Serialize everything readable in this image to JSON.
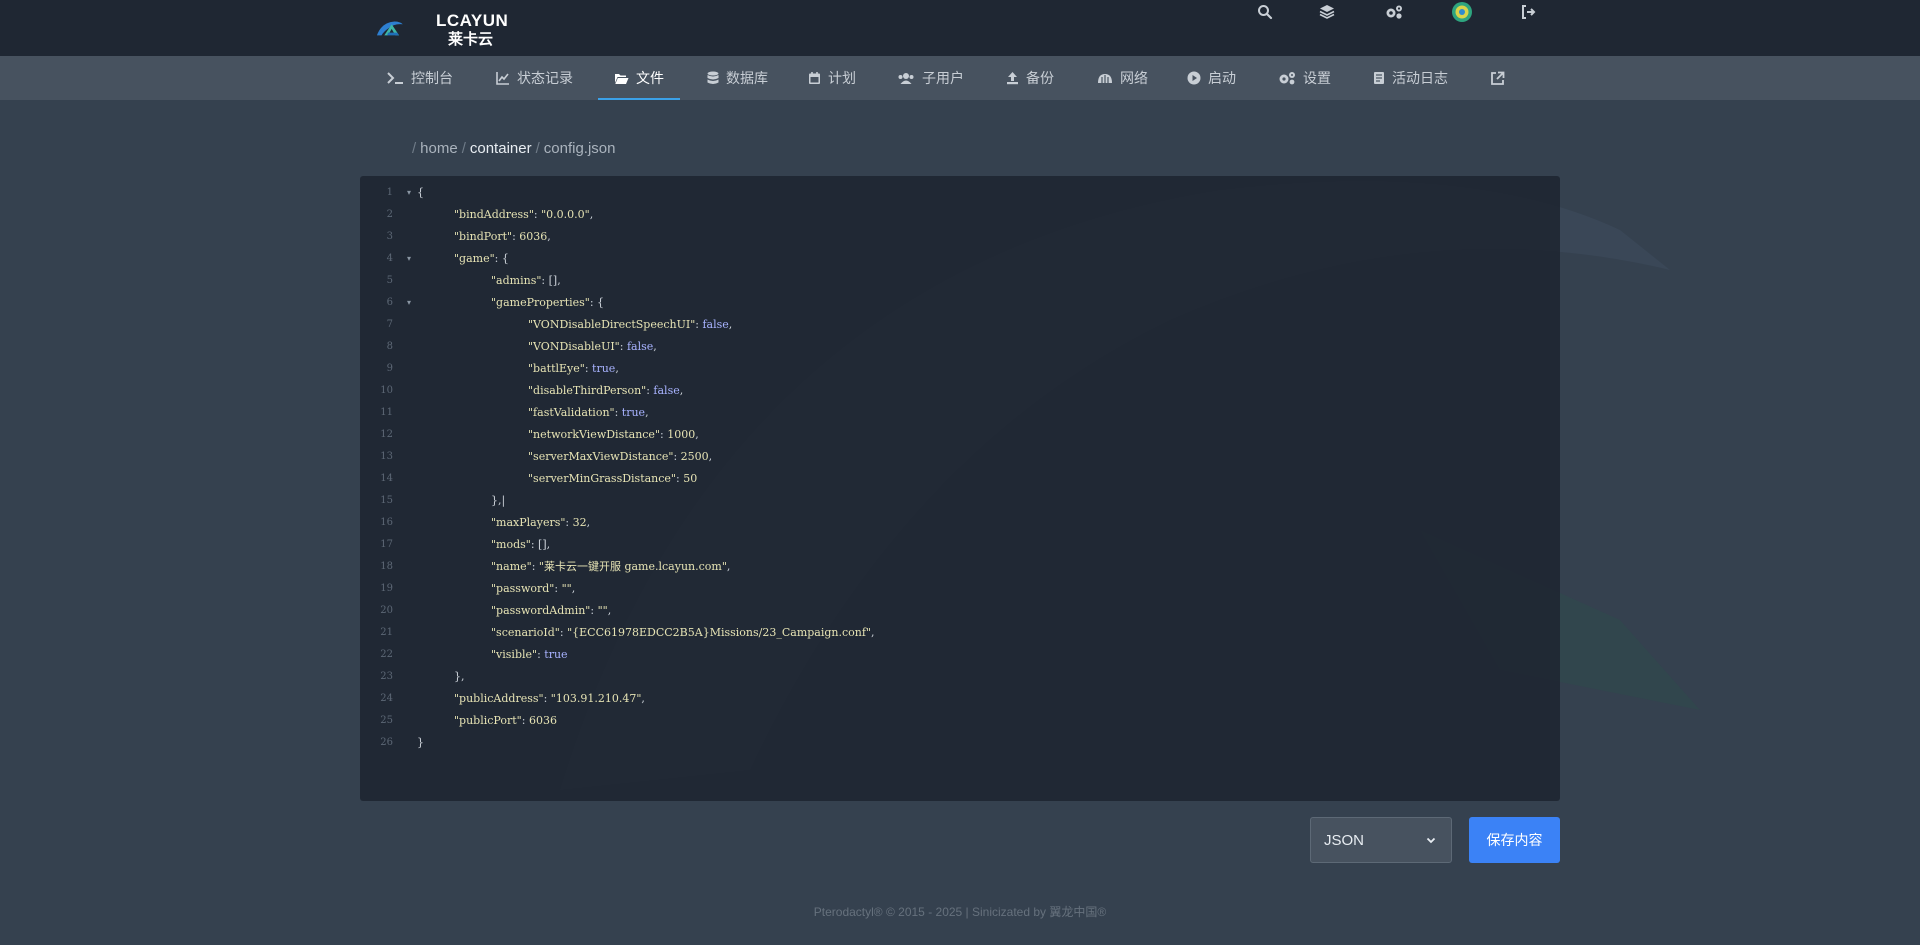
{
  "header": {
    "logo_text": "LCAYUN",
    "logo_sub": "莱卡云",
    "icons": [
      "search-icon",
      "layers-icon",
      "cogs-icon",
      "avatar",
      "logout-icon"
    ]
  },
  "nav": {
    "items": [
      {
        "label": "控制台",
        "icon": "terminal-icon"
      },
      {
        "label": "状态记录",
        "icon": "chart-icon"
      },
      {
        "label": "文件",
        "icon": "folder-open-icon",
        "active": true
      },
      {
        "label": "数据库",
        "icon": "database-icon"
      },
      {
        "label": "计划",
        "icon": "calendar-icon"
      },
      {
        "label": "子用户",
        "icon": "users-icon"
      },
      {
        "label": "备份",
        "icon": "upload-icon"
      },
      {
        "label": "网络",
        "icon": "network-icon"
      },
      {
        "label": "启动",
        "icon": "play-icon"
      },
      {
        "label": "设置",
        "icon": "settings-icon"
      },
      {
        "label": "活动日志",
        "icon": "log-icon"
      },
      {
        "label": "",
        "icon": "external-link-icon"
      }
    ]
  },
  "breadcrumb": {
    "sep1": "/",
    "home": "home",
    "sep2": "/",
    "container": "container",
    "sep3": "/",
    "file": "config.json"
  },
  "editor": {
    "lines": [
      {
        "n": "1",
        "fold": true,
        "indent": 0,
        "parts": [
          [
            "p",
            "{"
          ]
        ]
      },
      {
        "n": "2",
        "indent": 1,
        "parts": [
          [
            "k",
            "\"bindAddress\""
          ],
          [
            "p",
            ": "
          ],
          [
            "s",
            "\"0.0.0.0\""
          ],
          [
            "p",
            ","
          ]
        ]
      },
      {
        "n": "3",
        "indent": 1,
        "parts": [
          [
            "k",
            "\"bindPort\""
          ],
          [
            "p",
            ": "
          ],
          [
            "n",
            "6036"
          ],
          [
            "p",
            ","
          ]
        ]
      },
      {
        "n": "4",
        "fold": true,
        "indent": 1,
        "parts": [
          [
            "k",
            "\"game\""
          ],
          [
            "p",
            ": {"
          ]
        ]
      },
      {
        "n": "5",
        "indent": 2,
        "parts": [
          [
            "k",
            "\"admins\""
          ],
          [
            "p",
            ": [],"
          ]
        ]
      },
      {
        "n": "6",
        "fold": true,
        "indent": 2,
        "parts": [
          [
            "k",
            "\"gameProperties\""
          ],
          [
            "p",
            ": {"
          ]
        ]
      },
      {
        "n": "7",
        "indent": 3,
        "parts": [
          [
            "k",
            "\"VONDisableDirectSpeechUI\""
          ],
          [
            "p",
            ": "
          ],
          [
            "b",
            "false"
          ],
          [
            "p",
            ","
          ]
        ]
      },
      {
        "n": "8",
        "indent": 3,
        "parts": [
          [
            "k",
            "\"VONDisableUI\""
          ],
          [
            "p",
            ": "
          ],
          [
            "b",
            "false"
          ],
          [
            "p",
            ","
          ]
        ]
      },
      {
        "n": "9",
        "indent": 3,
        "parts": [
          [
            "k",
            "\"battlEye\""
          ],
          [
            "p",
            ": "
          ],
          [
            "b",
            "true"
          ],
          [
            "p",
            ","
          ]
        ]
      },
      {
        "n": "10",
        "indent": 3,
        "parts": [
          [
            "k",
            "\"disableThirdPerson\""
          ],
          [
            "p",
            ": "
          ],
          [
            "b",
            "false"
          ],
          [
            "p",
            ","
          ]
        ]
      },
      {
        "n": "11",
        "indent": 3,
        "parts": [
          [
            "k",
            "\"fastValidation\""
          ],
          [
            "p",
            ": "
          ],
          [
            "b",
            "true"
          ],
          [
            "p",
            ","
          ]
        ]
      },
      {
        "n": "12",
        "indent": 3,
        "parts": [
          [
            "k",
            "\"networkViewDistance\""
          ],
          [
            "p",
            ": "
          ],
          [
            "n",
            "1000"
          ],
          [
            "p",
            ","
          ]
        ]
      },
      {
        "n": "13",
        "indent": 3,
        "parts": [
          [
            "k",
            "\"serverMaxViewDistance\""
          ],
          [
            "p",
            ": "
          ],
          [
            "n",
            "2500"
          ],
          [
            "p",
            ","
          ]
        ]
      },
      {
        "n": "14",
        "indent": 3,
        "parts": [
          [
            "k",
            "\"serverMinGrassDistance\""
          ],
          [
            "p",
            ": "
          ],
          [
            "n",
            "50"
          ]
        ]
      },
      {
        "n": "15",
        "indent": 2,
        "parts": [
          [
            "p",
            "},|"
          ]
        ]
      },
      {
        "n": "16",
        "indent": 2,
        "parts": [
          [
            "k",
            "\"maxPlayers\""
          ],
          [
            "p",
            ": "
          ],
          [
            "n",
            "32"
          ],
          [
            "p",
            ","
          ]
        ]
      },
      {
        "n": "17",
        "indent": 2,
        "parts": [
          [
            "k",
            "\"mods\""
          ],
          [
            "p",
            ": [],"
          ]
        ]
      },
      {
        "n": "18",
        "indent": 2,
        "parts": [
          [
            "k",
            "\"name\""
          ],
          [
            "p",
            ": "
          ],
          [
            "s",
            "\"莱卡云一键开服 game.lcayun.com\""
          ],
          [
            "p",
            ","
          ]
        ]
      },
      {
        "n": "19",
        "indent": 2,
        "parts": [
          [
            "k",
            "\"password\""
          ],
          [
            "p",
            ": "
          ],
          [
            "s",
            "\"\""
          ],
          [
            "p",
            ","
          ]
        ]
      },
      {
        "n": "20",
        "indent": 2,
        "parts": [
          [
            "k",
            "\"passwordAdmin\""
          ],
          [
            "p",
            ": "
          ],
          [
            "s",
            "\"\""
          ],
          [
            "p",
            ","
          ]
        ]
      },
      {
        "n": "21",
        "indent": 2,
        "parts": [
          [
            "k",
            "\"scenarioId\""
          ],
          [
            "p",
            ": "
          ],
          [
            "s",
            "\"{ECC61978EDCC2B5A}Missions/23_Campaign.conf\""
          ],
          [
            "p",
            ","
          ]
        ]
      },
      {
        "n": "22",
        "indent": 2,
        "parts": [
          [
            "k",
            "\"visible\""
          ],
          [
            "p",
            ": "
          ],
          [
            "b",
            "true"
          ]
        ]
      },
      {
        "n": "23",
        "indent": 1,
        "parts": [
          [
            "p",
            "},"
          ]
        ]
      },
      {
        "n": "24",
        "indent": 1,
        "parts": [
          [
            "k",
            "\"publicAddress\""
          ],
          [
            "p",
            ": "
          ],
          [
            "s",
            "\"103.91.210.47\""
          ],
          [
            "p",
            ","
          ]
        ]
      },
      {
        "n": "25",
        "indent": 1,
        "parts": [
          [
            "k",
            "\"publicPort\""
          ],
          [
            "p",
            ": "
          ],
          [
            "n",
            "6036"
          ]
        ]
      },
      {
        "n": "26",
        "indent": 0,
        "parts": [
          [
            "p",
            "}"
          ]
        ]
      }
    ]
  },
  "controls": {
    "language": "JSON",
    "save_label": "保存内容"
  },
  "footer": {
    "text": "Pterodactyl® © 2015 - 2025 | Sinicizated by 翼龙中国®"
  },
  "colors": {
    "accent": "#3b82f6",
    "nav_active_underline": "#3ba1e8",
    "boolean": "#a8b3ff",
    "string": "#e6e3b4"
  }
}
